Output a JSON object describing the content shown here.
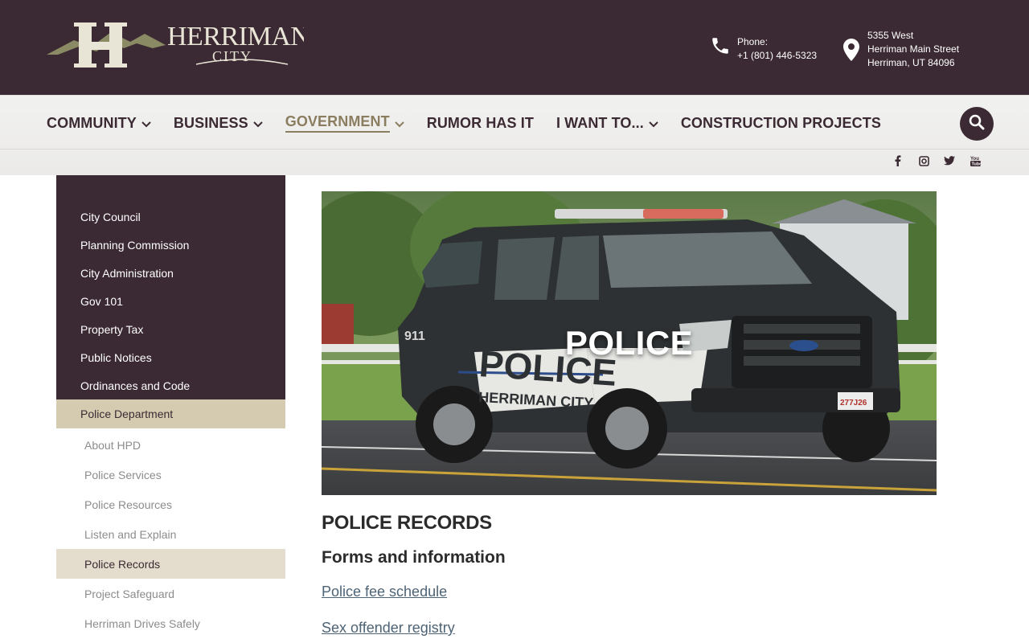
{
  "header": {
    "logo_text": "HERRIMAN",
    "logo_subtext": "CITY",
    "phone_label": "Phone:",
    "phone_number": "+1 (801) 446-5323",
    "address_line1": "5355 West",
    "address_line2": "Herriman Main Street",
    "address_line3": "Herriman, UT 84096"
  },
  "nav": {
    "items": [
      {
        "label": "COMMUNITY",
        "has_dropdown": true
      },
      {
        "label": "BUSINESS",
        "has_dropdown": true
      },
      {
        "label": "GOVERNMENT",
        "has_dropdown": true,
        "active": true
      },
      {
        "label": "RUMOR HAS IT",
        "has_dropdown": false
      },
      {
        "label": "I WANT TO...",
        "has_dropdown": true
      },
      {
        "label": "CONSTRUCTION PROJECTS",
        "has_dropdown": false
      }
    ],
    "social": [
      "facebook-icon",
      "instagram-icon",
      "twitter-icon",
      "youtube-icon"
    ]
  },
  "sidebar": {
    "items": [
      {
        "label": "City Council"
      },
      {
        "label": "Planning Commission"
      },
      {
        "label": "City Administration"
      },
      {
        "label": "Gov 101"
      },
      {
        "label": "Property Tax"
      },
      {
        "label": "Public Notices"
      },
      {
        "label": "Ordinances and Code"
      },
      {
        "label": "Police Department"
      }
    ],
    "subitems": [
      {
        "label": "About HPD"
      },
      {
        "label": "Police Services"
      },
      {
        "label": "Police Resources"
      },
      {
        "label": "Listen and Explain"
      },
      {
        "label": "Police Records"
      },
      {
        "label": "Project Safeguard"
      },
      {
        "label": "Herriman Drives Safely"
      }
    ]
  },
  "main": {
    "hero_title": "POLICE",
    "section_title": "POLICE RECORDS",
    "subtitle": "Forms and information",
    "links": [
      "Police fee schedule",
      "Sex offender registry"
    ]
  },
  "colors": {
    "brand_dark": "#3b2a33",
    "accent_gold": "#8b7d5f",
    "sidebar_active": "#d5cbb0",
    "link": "#4d6376"
  }
}
